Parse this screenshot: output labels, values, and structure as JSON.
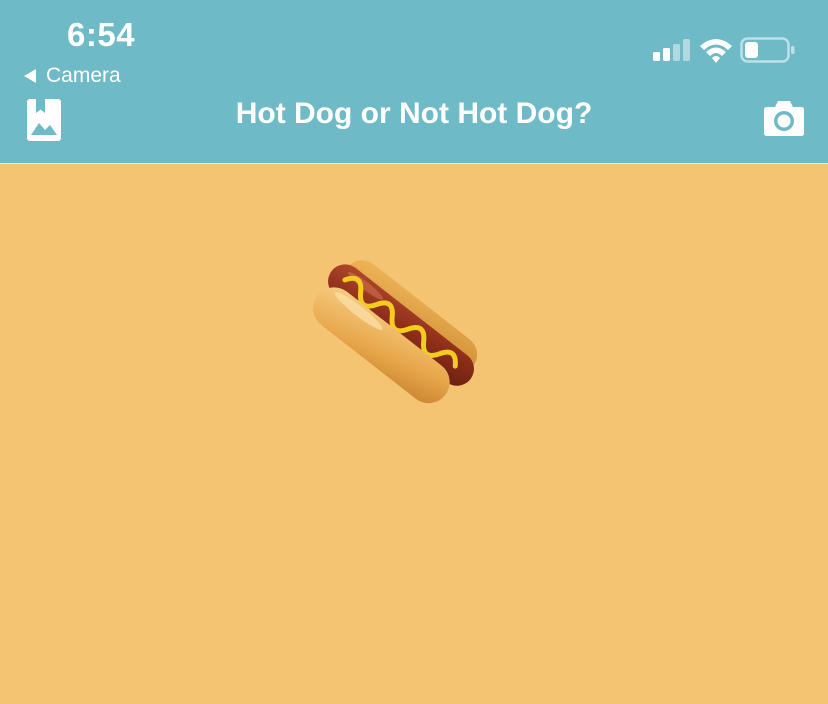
{
  "status_bar": {
    "time": "6:54",
    "back_app_label": "Camera",
    "signal_bars": 2,
    "battery_level": 0.3
  },
  "nav": {
    "title": "Hot Dog or Not Hot Dog?",
    "left_icon": "photo-library-icon",
    "right_icon": "camera-icon"
  },
  "content": {
    "image": "hot-dog-emoji"
  },
  "colors": {
    "header_bg": "#6fbac7",
    "body_bg": "#f5c473",
    "text": "#ffffff"
  }
}
